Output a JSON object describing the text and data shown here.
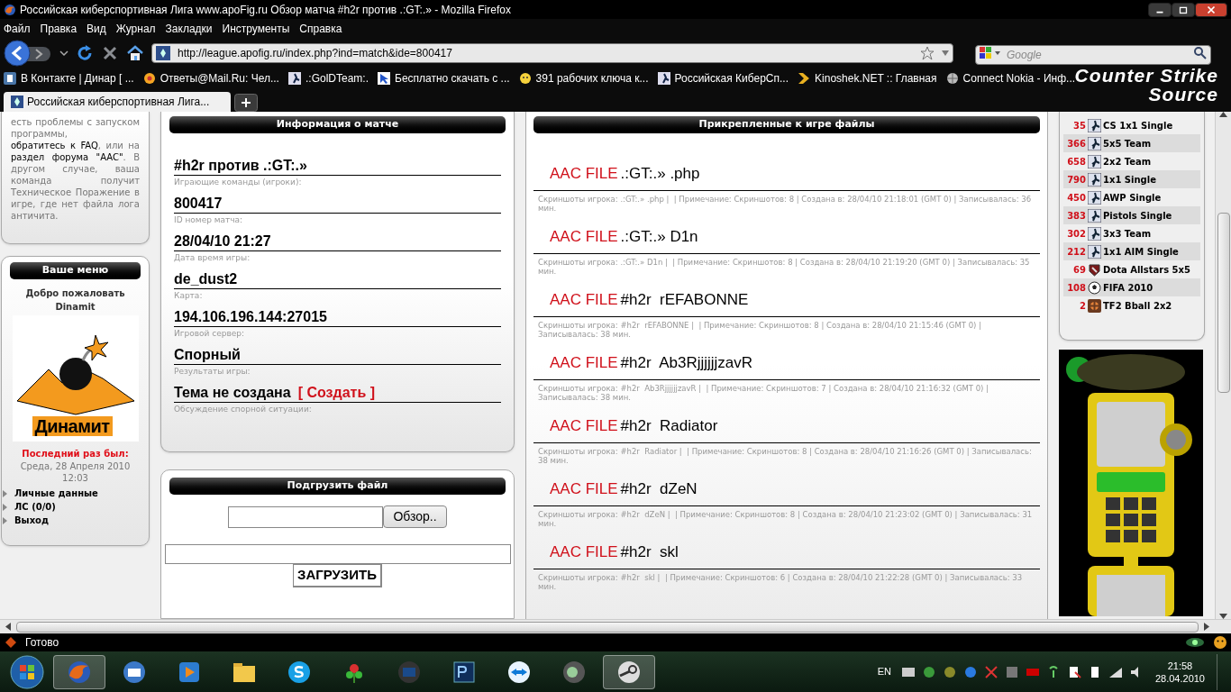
{
  "window": {
    "title": "Российская киберспортивная Лига www.apoFig.ru  Обзор матча #h2r против .:GT:.» - Mozilla Firefox"
  },
  "menu": [
    "Файл",
    "Правка",
    "Вид",
    "Журнал",
    "Закладки",
    "Инструменты",
    "Справка"
  ],
  "nav": {
    "url": "http://league.apofig.ru/index.php?ind=match&ide=800417",
    "search_placeholder": "Google"
  },
  "theme_logo": [
    "Counter Strike",
    "Source"
  ],
  "bookmarks": [
    {
      "label": "В Контакте | Динар [ ...",
      "kind": "vk"
    },
    {
      "label": "Ответы@Mail.Ru: Чел...",
      "kind": "mail"
    },
    {
      "label": ".:GolDTeam:.",
      "kind": "cs"
    },
    {
      "label": "Бесплатно скачать с ...",
      "kind": "cursor"
    },
    {
      "label": "391 рабочих ключа к...",
      "kind": "smile"
    },
    {
      "label": "Российская КиберСп...",
      "kind": "cs"
    },
    {
      "label": "Kinoshek.NET :: Главная",
      "kind": "k"
    },
    {
      "label": "Connect Nokia - Инф...",
      "kind": "globe"
    }
  ],
  "tabs": [
    {
      "label": "Российская киберспортивная Лига...",
      "selected": true
    }
  ],
  "notice": "есть проблемы с запуском программы, **обратитесь к FAQ**, или на **раздел форума \"AAC\"**. В другом случае, ваша команда получит Техническое Поражение в игре, где нет файла лога античита.",
  "user_menu": {
    "title": "Ваше меню",
    "greeting": "Добро пожаловать",
    "username": "Dinamit",
    "logo_text": "Динамит",
    "last_seen_label": "Последний раз был:",
    "last_seen": "Среда, 28 Апреля 2010 12:03",
    "links": [
      "Личные данные",
      "ЛС (0/0)",
      "Выход"
    ]
  },
  "match_info": {
    "title": "Информация о матче",
    "fields": [
      {
        "value": "#h2r против .:GT:.»",
        "label": "Играющие команды (игроки):"
      },
      {
        "value": "800417",
        "label": "ID номер матча:"
      },
      {
        "value": "28/04/10 21:27",
        "label": "Дата время игры:"
      },
      {
        "value": "de_dust2",
        "label": "Карта:"
      },
      {
        "value": "194.106.196.144:27015",
        "label": "Игровой сервер:"
      },
      {
        "value": "Спорный",
        "label": "Результаты игры:"
      },
      {
        "value": "Тема не создана",
        "label": "Обсуждение спорной ситуации:",
        "action": "[ Создать ]"
      }
    ]
  },
  "upload": {
    "title": "Подгрузить файл",
    "browse_button": "Обзор..",
    "upload_button": "ЗАГРУЗИТЬ"
  },
  "files": {
    "title": "Прикрепленные к игре файлы",
    "items": [
      {
        "prefix": "AAC FILE",
        "name": ".:GT:.» .php",
        "meta": "Скриншоты игрока: .:GT:.» .php |  | Примечание: Скриншотов: 8 | Создана в: 28/04/10 21:18:01 (GMT 0) | Записывалась: 36 мин."
      },
      {
        "prefix": "AAC FILE",
        "name": ".:GT:.» D1n",
        "meta": "Скриншоты игрока: .:GT:.» D1n |  | Примечание: Скриншотов: 8 | Создана в: 28/04/10 21:19:20 (GMT 0) | Записывалась: 35 мин."
      },
      {
        "prefix": "AAC FILE",
        "name": "#h2r  rEFABONNE",
        "meta": "Скриншоты игрока: #h2r  rEFABONNE |  | Примечание: Скриншотов: 8 | Создана в: 28/04/10 21:15:46 (GMT 0) | Записывалась: 38 мин."
      },
      {
        "prefix": "AAC FILE",
        "name": "#h2r  Ab3RjjjjjjzavR",
        "meta": "Скриншоты игрока: #h2r  Ab3RjjjjjjzavR |  | Примечание: Скриншотов: 7 | Создана в: 28/04/10 21:16:32 (GMT 0) | Записывалась: 38 мин."
      },
      {
        "prefix": "AAC FILE",
        "name": "#h2r  Radiator",
        "meta": "Скриншоты игрока: #h2r  Radiator |  | Примечание: Скриншотов: 8 | Создана в: 28/04/10 21:16:26 (GMT 0) | Записывалась: 38 мин."
      },
      {
        "prefix": "AAC FILE",
        "name": "#h2r  dZeN",
        "meta": "Скриншоты игрока: #h2r  dZeN |  | Примечание: Скриншотов: 8 | Создана в: 28/04/10 21:23:02 (GMT 0) | Записывалась: 31 мин."
      },
      {
        "prefix": "AAC FILE",
        "name": "#h2r  skl",
        "meta": "Скриншоты игрока: #h2r  skl |  | Примечание: Скриншотов: 6 | Создана в: 28/04/10 21:22:28 (GMT 0) | Записывалась: 33 мин."
      }
    ]
  },
  "ladders": [
    {
      "count": "35",
      "name": "CS 1x1 Single",
      "kind": "cs"
    },
    {
      "count": "366",
      "name": "5x5 Team",
      "kind": "cs"
    },
    {
      "count": "658",
      "name": "2x2 Team",
      "kind": "cs"
    },
    {
      "count": "790",
      "name": "1x1 Single",
      "kind": "cs"
    },
    {
      "count": "450",
      "name": "AWP Single",
      "kind": "cs"
    },
    {
      "count": "383",
      "name": "Pistols Single",
      "kind": "cs"
    },
    {
      "count": "302",
      "name": "3x3 Team",
      "kind": "cs"
    },
    {
      "count": "212",
      "name": "1x1 AIM Single",
      "kind": "cs"
    },
    {
      "count": "69",
      "name": "Dota Allstars 5x5",
      "kind": "dota"
    },
    {
      "count": "108",
      "name": "FIFA 2010",
      "kind": "ball"
    },
    {
      "count": "2",
      "name": "TF2 Bball 2x2",
      "kind": "tf2"
    }
  ],
  "status_bar": {
    "text": "Готово"
  },
  "taskbar": {
    "apps": [
      {
        "kind": "firefox",
        "active": true
      },
      {
        "kind": "mail",
        "active": false
      },
      {
        "kind": "media",
        "active": false
      },
      {
        "kind": "folder",
        "active": false
      },
      {
        "kind": "skype",
        "active": false
      },
      {
        "kind": "plant",
        "active": false
      },
      {
        "kind": "monitor",
        "active": false
      },
      {
        "kind": "ps",
        "active": false
      },
      {
        "kind": "teamviewer",
        "active": false
      },
      {
        "kind": "speaker",
        "active": false
      },
      {
        "kind": "steam",
        "active": true
      }
    ],
    "language": "EN",
    "time": "21:58",
    "date": "28.04.2010"
  }
}
